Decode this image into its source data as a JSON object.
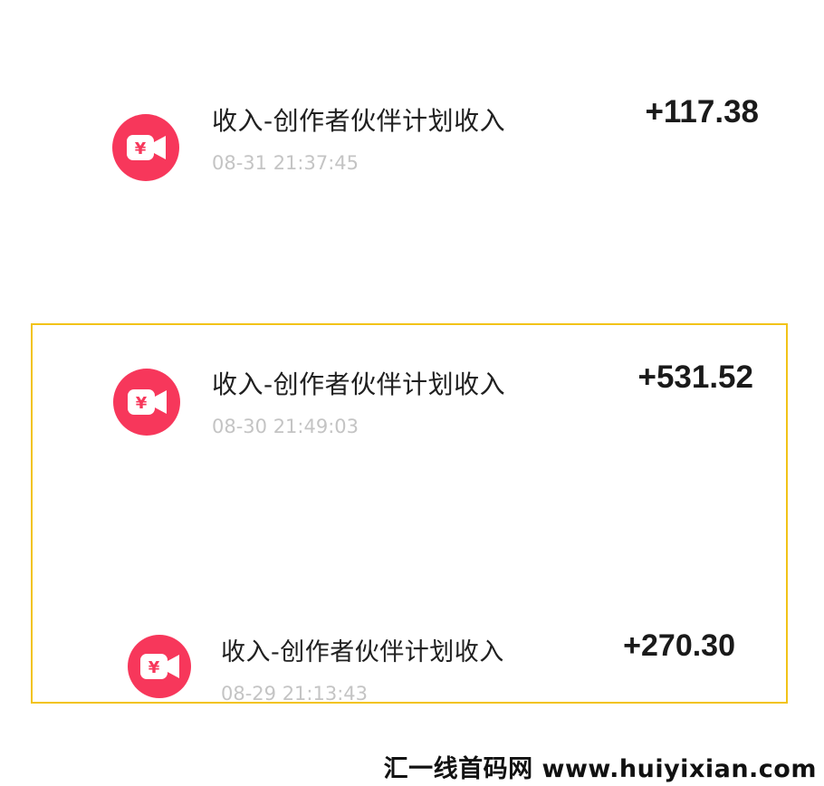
{
  "transactions": [
    {
      "title": "收入-创作者伙伴计划收入",
      "time": "08-31 21:37:45",
      "amount": "+117.38",
      "icon": "yen-video-camera-icon"
    },
    {
      "title": "收入-创作者伙伴计划收入",
      "time": "08-30 21:49:03",
      "amount": "+531.52",
      "icon": "yen-video-camera-icon"
    },
    {
      "title": "收入-创作者伙伴计划收入",
      "time": "08-29 21:13:43",
      "amount": "+270.30",
      "icon": "yen-video-camera-icon"
    }
  ],
  "colors": {
    "icon_bg": "#f7375b",
    "highlight_border": "#f2c318",
    "title_text": "#202020",
    "time_text": "#c4c4c4"
  },
  "watermark": "汇一线首码网 www.huiyixian.com"
}
